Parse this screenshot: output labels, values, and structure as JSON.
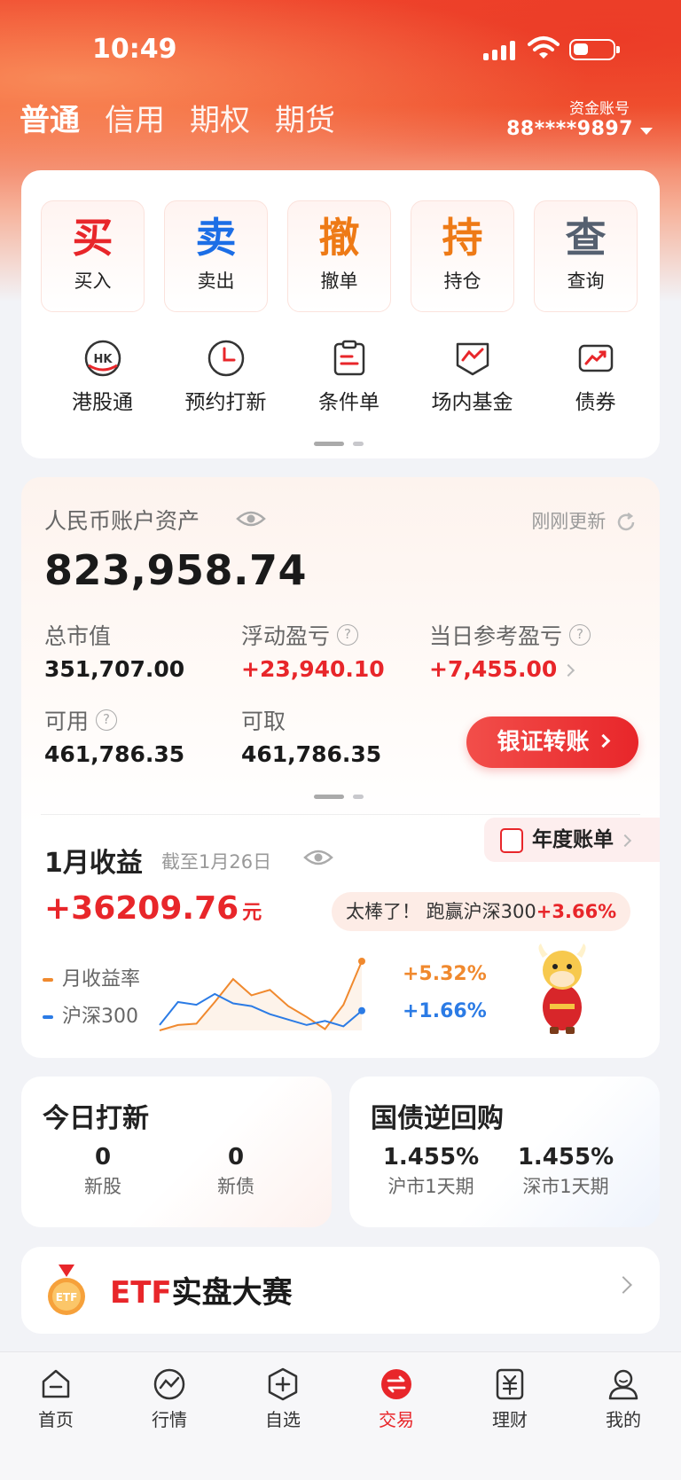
{
  "status_bar": {
    "time": "10:49"
  },
  "header": {
    "tabs": [
      {
        "label": "普通",
        "active": true
      },
      {
        "label": "信用"
      },
      {
        "label": "期权"
      },
      {
        "label": "期货"
      }
    ],
    "account_label": "资金账号",
    "account_number": "88****9897"
  },
  "quick_actions": [
    {
      "char": "买",
      "label": "买入",
      "color": "#e8262a"
    },
    {
      "char": "卖",
      "label": "卖出",
      "color": "#1c6ee6"
    },
    {
      "char": "撤",
      "label": "撤单",
      "color": "#ee7a16"
    },
    {
      "char": "持",
      "label": "持仓",
      "color": "#ee7a16"
    },
    {
      "char": "查",
      "label": "查询",
      "color": "#556070"
    }
  ],
  "tools": [
    {
      "label": "港股通",
      "icon": "hk-icon",
      "icon_text": "HK"
    },
    {
      "label": "预约打新",
      "icon": "clock-icon"
    },
    {
      "label": "条件单",
      "icon": "clipboard-icon"
    },
    {
      "label": "场内基金",
      "icon": "fund-chart-icon"
    },
    {
      "label": "债券",
      "icon": "bond-trend-icon"
    }
  ],
  "assets": {
    "title": "人民币账户资产",
    "updated": "刚刚更新",
    "total": "823,958.74",
    "market_value_label": "总市值",
    "market_value": "351,707.00",
    "floating_pnl_label": "浮动盈亏",
    "floating_pnl": "+23,940.10",
    "daily_pnl_label": "当日参考盈亏",
    "daily_pnl": "+7,455.00",
    "available_label": "可用",
    "available": "461,786.35",
    "withdrawable_label": "可取",
    "withdrawable": "461,786.35",
    "transfer_button": "银证转账"
  },
  "monthly": {
    "title": "1月收益",
    "subtitle": "截至1月26日",
    "year_bill": "年度账单",
    "value": "+36209.76",
    "unit": "元",
    "beat_text": "太棒了！ 跑赢沪深300",
    "beat_value": "+3.66%",
    "legend_rate": "月收益率",
    "legend_index": "沪深300",
    "rate_value": "+5.32%",
    "index_value": "+1.66%",
    "colors": {
      "rate": "#f0892e",
      "index": "#2b7be5"
    }
  },
  "chart_data": {
    "type": "line",
    "x": [
      1,
      2,
      3,
      4,
      5,
      6,
      7,
      8,
      9,
      10,
      11,
      12
    ],
    "series": [
      {
        "name": "月收益率",
        "values": [
          0.2,
          0.6,
          0.7,
          2.3,
          4.0,
          2.8,
          3.2,
          2.0,
          1.2,
          0.3,
          2.1,
          5.32
        ]
      },
      {
        "name": "沪深300",
        "values": [
          0.6,
          2.3,
          2.1,
          2.9,
          2.2,
          2.0,
          1.4,
          1.0,
          0.6,
          0.9,
          0.5,
          1.66
        ]
      }
    ]
  },
  "ipo": {
    "title": "今日打新",
    "stock_count": "0",
    "stock_label": "新股",
    "bond_count": "0",
    "bond_label": "新债"
  },
  "repo": {
    "title": "国债逆回购",
    "sh_rate": "1.455%",
    "sh_label": "沪市1天期",
    "sz_rate": "1.455%",
    "sz_label": "深市1天期"
  },
  "etf_banner": {
    "prefix": "ETF",
    "text": "实盘大赛",
    "medal_text": "ETF"
  },
  "bottom_nav": [
    {
      "label": "首页",
      "icon": "home-icon"
    },
    {
      "label": "行情",
      "icon": "market-icon"
    },
    {
      "label": "自选",
      "icon": "watchlist-icon"
    },
    {
      "label": "交易",
      "icon": "trade-icon",
      "active": true
    },
    {
      "label": "理财",
      "icon": "wealth-icon"
    },
    {
      "label": "我的",
      "icon": "profile-icon"
    }
  ]
}
